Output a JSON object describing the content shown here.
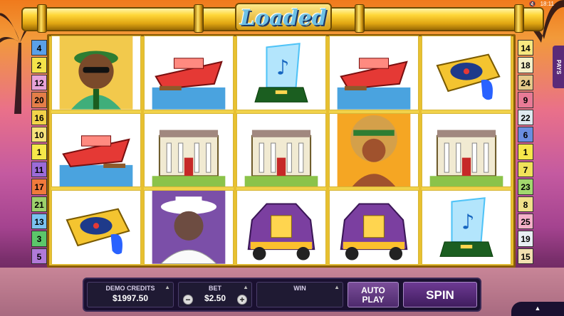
{
  "game": {
    "logo_text": "Loaded",
    "pays_tab_label": "PAYS"
  },
  "status_bar": {
    "mute_icon": "speaker-mute-icon",
    "time": "18:11"
  },
  "paylines_left": [
    {
      "num": "4",
      "color": "#5aa0e8"
    },
    {
      "num": "2",
      "color": "#f4e34a"
    },
    {
      "num": "12",
      "color": "#e7a3d8"
    },
    {
      "num": "20",
      "color": "#e47e48"
    },
    {
      "num": "16",
      "color": "#f2d34a"
    },
    {
      "num": "10",
      "color": "#f5e27a"
    },
    {
      "num": "1",
      "color": "#f6e84a"
    },
    {
      "num": "11",
      "color": "#9b6bd8"
    },
    {
      "num": "17",
      "color": "#f07a3c"
    },
    {
      "num": "21",
      "color": "#9dd06c"
    },
    {
      "num": "13",
      "color": "#7ac2f0"
    },
    {
      "num": "3",
      "color": "#5cc66a"
    },
    {
      "num": "5",
      "color": "#b07ad8"
    }
  ],
  "paylines_right": [
    {
      "num": "14",
      "color": "#f7e880"
    },
    {
      "num": "18",
      "color": "#f4f0c8"
    },
    {
      "num": "24",
      "color": "#e6c98a"
    },
    {
      "num": "9",
      "color": "#e87a96"
    },
    {
      "num": "22",
      "color": "#dfe9f0"
    },
    {
      "num": "6",
      "color": "#6a8de0"
    },
    {
      "num": "1",
      "color": "#f6e84a"
    },
    {
      "num": "7",
      "color": "#f0e25a"
    },
    {
      "num": "23",
      "color": "#a2d86e"
    },
    {
      "num": "8",
      "color": "#f0e08a"
    },
    {
      "num": "25",
      "color": "#f4b0c8"
    },
    {
      "num": "19",
      "color": "#e8eef4"
    },
    {
      "num": "15",
      "color": "#f2e0b0"
    }
  ],
  "reels": [
    [
      "big-man-symbol",
      "yacht-symbol",
      "turntable-symbol"
    ],
    [
      "yacht-symbol",
      "mansion-symbol",
      "rapper-symbol"
    ],
    [
      "music-award-symbol",
      "mansion-symbol",
      "limo-symbol"
    ],
    [
      "yacht-symbol",
      "diva-symbol",
      "limo-symbol"
    ],
    [
      "turntable-symbol",
      "mansion-symbol",
      "music-award-symbol"
    ]
  ],
  "console": {
    "credits_label": "DEMO CREDITS",
    "credits_value": "$1997.50",
    "bet_label": "BET",
    "bet_value": "$2.50",
    "bet_minus": "−",
    "bet_plus": "+",
    "win_label": "WIN",
    "win_value": "",
    "autoplay_line1": "AUTO",
    "autoplay_line2": "PLAY",
    "spin_label": "SPIN"
  },
  "colors": {
    "frame_gold": "#e8c030",
    "console_bg": "#1a1030",
    "button_purple": "#5b2a78"
  }
}
